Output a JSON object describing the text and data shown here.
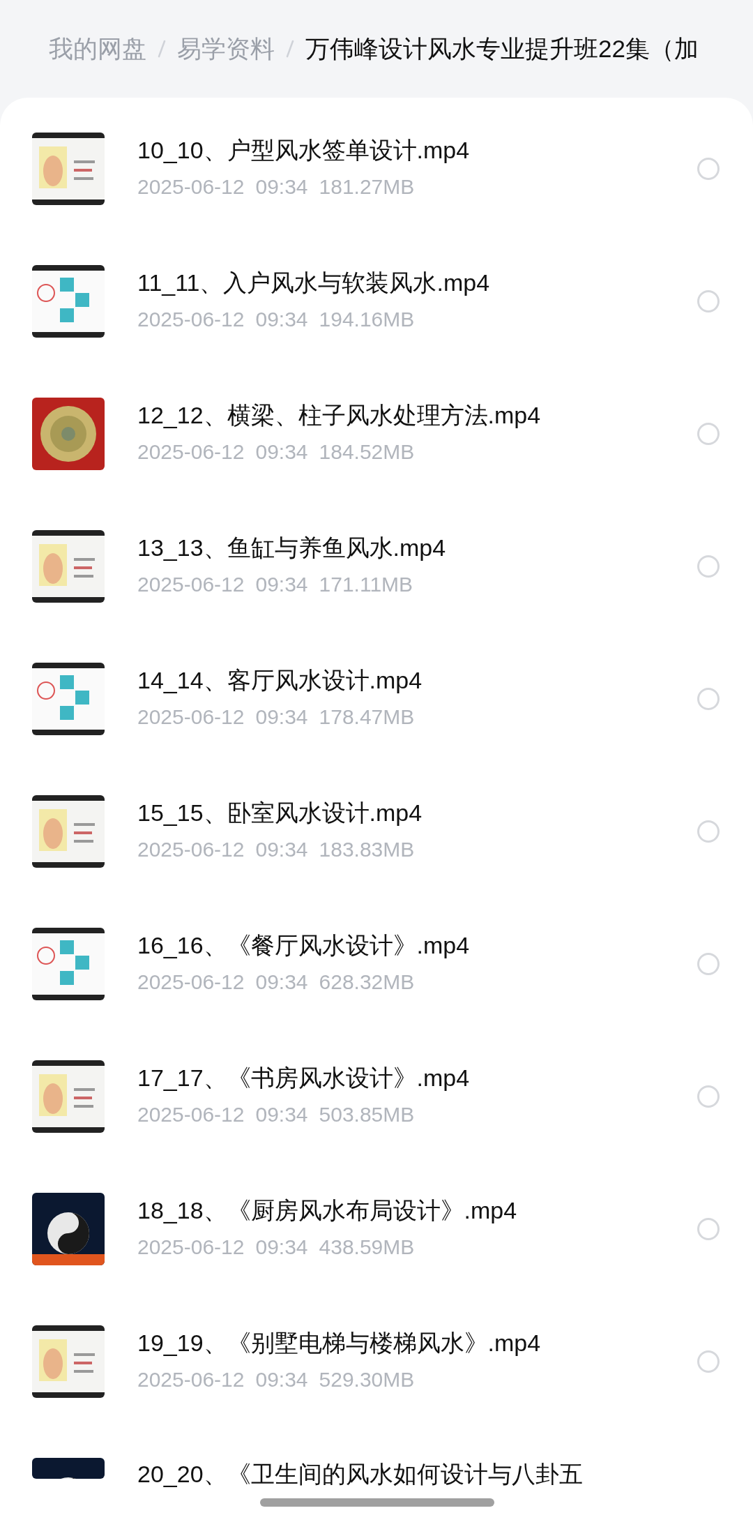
{
  "breadcrumb": [
    {
      "label": "我的网盘",
      "selected": false
    },
    {
      "label": "易学资料",
      "selected": false
    },
    {
      "label": "万伟峰设计风水专业提升班22集（加",
      "selected": true
    }
  ],
  "files": [
    {
      "name": "10_10、户型风水签单设计.mp4",
      "date": "2025-06-12",
      "time": "09:34",
      "size": "181.27MB",
      "selected": false
    },
    {
      "name": "11_11、入户风水与软装风水.mp4",
      "date": "2025-06-12",
      "time": "09:34",
      "size": "194.16MB",
      "selected": false
    },
    {
      "name": "12_12、横梁、柱子风水处理方法.mp4",
      "date": "2025-06-12",
      "time": "09:34",
      "size": "184.52MB",
      "selected": false
    },
    {
      "name": "13_13、鱼缸与养鱼风水.mp4",
      "date": "2025-06-12",
      "time": "09:34",
      "size": "171.11MB",
      "selected": false
    },
    {
      "name": "14_14、客厅风水设计.mp4",
      "date": "2025-06-12",
      "time": "09:34",
      "size": "178.47MB",
      "selected": false
    },
    {
      "name": "15_15、卧室风水设计.mp4",
      "date": "2025-06-12",
      "time": "09:34",
      "size": "183.83MB",
      "selected": false
    },
    {
      "name": "16_16、《餐厅风水设计》.mp4",
      "date": "2025-06-12",
      "time": "09:34",
      "size": "628.32MB",
      "selected": false
    },
    {
      "name": "17_17、《书房风水设计》.mp4",
      "date": "2025-06-12",
      "time": "09:34",
      "size": "503.85MB",
      "selected": false
    },
    {
      "name": "18_18、《厨房风水布局设计》.mp4",
      "date": "2025-06-12",
      "time": "09:34",
      "size": "438.59MB",
      "selected": false
    },
    {
      "name": "19_19、《别墅电梯与楼梯风水》.mp4",
      "date": "2025-06-12",
      "time": "09:34",
      "size": "529.30MB",
      "selected": false
    }
  ],
  "partial_file": {
    "name": "20_20、《卫生间的风水如何设计与八卦五"
  }
}
